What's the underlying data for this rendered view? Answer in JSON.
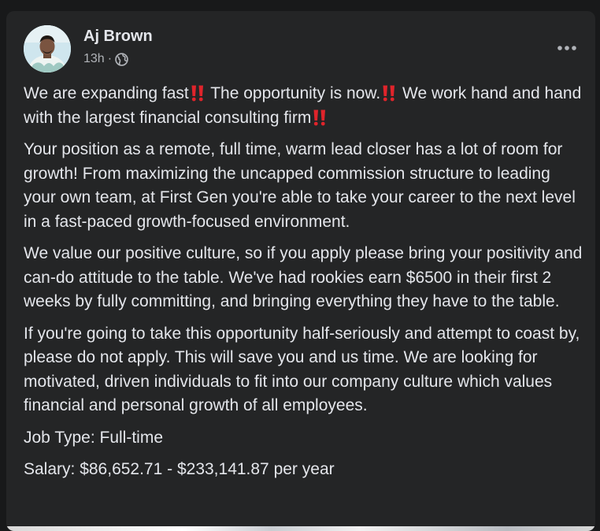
{
  "post": {
    "author": "Aj Brown",
    "time": "13h",
    "separator": "·",
    "privacy_icon": "globe-icon",
    "more_icon": "more-horizontal-icon",
    "emoji_icon": "double-exclamation-emoji",
    "paragraphs": {
      "p1_a": "We are expanding fast",
      "p1_b": " The opportunity is now.",
      "p1_c": " We work hand and hand with the largest financial consulting firm",
      "p2": "Your position as a remote, full time, warm lead closer has a lot of room for growth! From maximizing the uncapped commission structure to leading your own team, at First Gen you're able to take your career to the next level in a fast-paced growth-focused environment.",
      "p3": "We value our positive culture, so if you apply please bring your positivity and can-do attitude to the table. We've had rookies earn $6500 in their first 2 weeks by fully committing, and bringing everything they have to the table.",
      "p4": "If you're going to take this opportunity half-seriously and attempt to coast by, please do not apply. This will save you and us time. We are looking for motivated, driven individuals to fit into our company culture which values financial and personal growth of all employees.",
      "job_type": "Job Type: Full-time",
      "salary": "Salary: $86,652.71 - $233,141.87 per year"
    }
  },
  "colors": {
    "page_bg": "#18191a",
    "card_bg": "#242526",
    "primary_text": "#e4e6eb",
    "secondary_text": "#b0b3b8",
    "emoji_red": "#e0242b"
  }
}
